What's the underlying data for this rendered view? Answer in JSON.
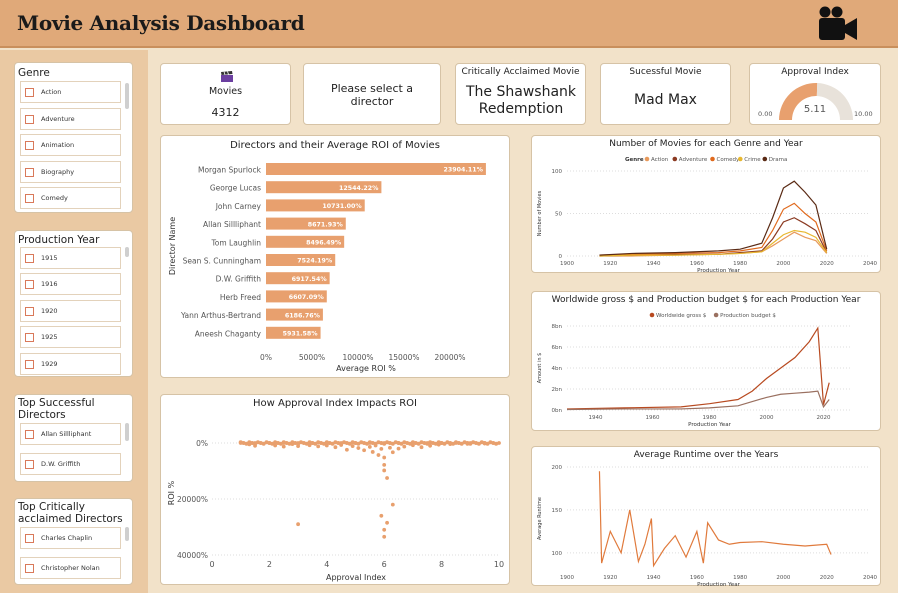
{
  "header": {
    "title": "Movie Analysis Dashboard"
  },
  "colors": {
    "accent": "#e8a06e",
    "dark_orange": "#d9663a",
    "header_bg": "#e0a979"
  },
  "slicers": {
    "genre": {
      "title": "Genre",
      "items": [
        "Action",
        "Adventure",
        "Animation",
        "Biography",
        "Comedy"
      ]
    },
    "year": {
      "title": "Production Year",
      "items": [
        "1915",
        "1916",
        "1920",
        "1925",
        "1929"
      ]
    },
    "top_successful": {
      "title": "Top Successful Directors",
      "items": [
        "Allan Sillliphant",
        "D.W. Griffith"
      ]
    },
    "top_acclaimed": {
      "title": "Top Critically acclaimed Directors",
      "items": [
        "Charles Chaplin",
        "Christopher Nolan"
      ]
    }
  },
  "kpis": {
    "movies": {
      "icon": "clapperboard-icon",
      "label": "Movies",
      "value": "4312"
    },
    "director": {
      "label": "Please select a director"
    },
    "acclaimed": {
      "label": "Critically Acclaimed Movie",
      "value": "The Shawshank Redemption"
    },
    "successful": {
      "label": "Sucessful Movie",
      "value": "Mad Max"
    },
    "approval": {
      "label": "Approval Index",
      "value": 5.11,
      "value_text": "5.11",
      "min": "0.00",
      "max": "10.00"
    }
  },
  "charts": {
    "roi_bar": {
      "title": "Directors and their Average ROI of Movies",
      "ylabel": "Director Name",
      "xlabel": "Average ROI %",
      "xticks": [
        "0%",
        "5000%",
        "10000%",
        "15000%",
        "20000%"
      ],
      "directors": [
        {
          "name": "Morgan Spurlock",
          "label": "23904.11%"
        },
        {
          "name": "George Lucas",
          "label": "12544.22%"
        },
        {
          "name": "John Carney",
          "label": "10731.00%"
        },
        {
          "name": "Allan Sillliphant",
          "label": "8671.93%"
        },
        {
          "name": "Tom Laughlin",
          "label": "8496.49%"
        },
        {
          "name": "Sean S. Cunningham",
          "label": "7524.19%"
        },
        {
          "name": "D.W. Griffith",
          "label": "6917.54%"
        },
        {
          "name": "Herb Freed",
          "label": "6607.09%"
        },
        {
          "name": "Yann Arthus-Bertrand",
          "label": "6186.76%"
        },
        {
          "name": "Aneesh Chaganty",
          "label": "5931.58%"
        }
      ]
    },
    "scatter": {
      "title": "How Approval Index Impacts ROI",
      "ylabel": "ROI %",
      "xlabel": "Approval Index",
      "xticks": [
        "0",
        "2",
        "4",
        "6",
        "8",
        "10"
      ],
      "yticks": [
        "0%",
        "20000%",
        "40000%"
      ]
    },
    "genre_lines": {
      "title": "Number of Movies for each Genre and Year",
      "legend_title": "Genre",
      "legend": [
        "Action",
        "Adventure",
        "Comedy",
        "Crime",
        "Drama"
      ],
      "xlabel": "Production Year",
      "ylabel": "Number of Movies",
      "xticks": [
        "1900",
        "1920",
        "1940",
        "1960",
        "1980",
        "2000",
        "2020",
        "2040"
      ],
      "yticks": [
        "100",
        "50",
        "0"
      ]
    },
    "gross_budget": {
      "title": "Worldwide gross $ and Production budget $ for each Production Year",
      "legend": [
        "Worldwide gross $",
        "Production budget $"
      ],
      "xlabel": "Production Year",
      "ylabel": "Amount in $",
      "xticks": [
        "1940",
        "1960",
        "1980",
        "2000",
        "2020"
      ],
      "yticks": [
        "8bn",
        "6bn",
        "4bn",
        "2bn",
        "0bn"
      ]
    },
    "runtime": {
      "title": "Average Runtime over the Years",
      "xlabel": "Production Year",
      "ylabel": "Average Runtime",
      "xticks": [
        "1900",
        "1920",
        "1940",
        "1960",
        "1980",
        "2000",
        "2020",
        "2040"
      ],
      "yticks": [
        "200",
        "150",
        "100"
      ]
    }
  },
  "chart_data": [
    {
      "type": "bar",
      "title": "Directors and their Average ROI of Movies",
      "categories": [
        "Morgan Spurlock",
        "George Lucas",
        "John Carney",
        "Allan Sillliphant",
        "Tom Laughlin",
        "Sean S. Cunningham",
        "D.W. Griffith",
        "Herb Freed",
        "Yann Arthus-Bertrand",
        "Aneesh Chaganty"
      ],
      "values": [
        23904.11,
        12544.22,
        10731.0,
        8671.93,
        8496.49,
        7524.19,
        6917.54,
        6607.09,
        6186.76,
        5931.58
      ],
      "xlabel": "Average ROI %",
      "ylabel": "Director Name",
      "xlim": [
        0,
        25000
      ]
    },
    {
      "type": "scatter",
      "title": "How Approval Index Impacts ROI",
      "xlabel": "Approval Index",
      "ylabel": "ROI %",
      "xlim": [
        0,
        10
      ],
      "ylim": [
        0,
        40000
      ],
      "points": [
        [
          1.3,
          500
        ],
        [
          1.5,
          1000
        ],
        [
          2.2,
          900
        ],
        [
          2.5,
          1300
        ],
        [
          2.8,
          400
        ],
        [
          3.0,
          1100
        ],
        [
          3.4,
          800
        ],
        [
          3.7,
          1200
        ],
        [
          4.0,
          900
        ],
        [
          4.3,
          1500
        ],
        [
          4.5,
          700
        ],
        [
          4.7,
          2400
        ],
        [
          4.9,
          1100
        ],
        [
          5.1,
          1800
        ],
        [
          5.3,
          2600
        ],
        [
          5.5,
          1400
        ],
        [
          5.6,
          3200
        ],
        [
          5.7,
          900
        ],
        [
          5.8,
          4300
        ],
        [
          5.9,
          2100
        ],
        [
          6.0,
          5200
        ],
        [
          6.0,
          7800
        ],
        [
          6.0,
          9800
        ],
        [
          6.1,
          12500
        ],
        [
          6.2,
          1700
        ],
        [
          6.3,
          3300
        ],
        [
          6.5,
          2000
        ],
        [
          6.7,
          1300
        ],
        [
          7.0,
          800
        ],
        [
          7.3,
          1500
        ],
        [
          7.6,
          1000
        ],
        [
          7.9,
          600
        ],
        [
          8.3,
          400
        ],
        [
          8.9,
          300
        ],
        [
          9.5,
          200
        ],
        [
          3.0,
          29000
        ],
        [
          5.9,
          26000
        ],
        [
          6.0,
          31000
        ],
        [
          6.0,
          33500
        ],
        [
          6.1,
          28500
        ],
        [
          6.3,
          22000
        ],
        [
          1.0,
          0
        ],
        [
          1.5,
          0
        ],
        [
          2.0,
          0
        ],
        [
          2.5,
          0
        ],
        [
          3.0,
          0
        ],
        [
          3.5,
          0
        ],
        [
          4.0,
          0
        ],
        [
          4.5,
          0
        ],
        [
          5.0,
          0
        ],
        [
          5.5,
          0
        ],
        [
          6.0,
          0
        ],
        [
          6.5,
          0
        ],
        [
          7.0,
          0
        ],
        [
          7.5,
          0
        ],
        [
          8.0,
          0
        ],
        [
          8.5,
          0
        ],
        [
          9.0,
          0
        ],
        [
          9.5,
          0
        ],
        [
          10.0,
          0
        ]
      ]
    },
    {
      "type": "line",
      "title": "Number of Movies for each Genre and Year",
      "xlabel": "Production Year",
      "ylabel": "Number of Movies",
      "xlim": [
        1900,
        2040
      ],
      "ylim": [
        0,
        100
      ],
      "series": [
        {
          "name": "Action",
          "x": [
            1915,
            1930,
            1950,
            1970,
            1980,
            1990,
            1995,
            2000,
            2005,
            2010,
            2015,
            2020
          ],
          "values": [
            0,
            0,
            1,
            2,
            3,
            5,
            12,
            20,
            28,
            22,
            18,
            3
          ]
        },
        {
          "name": "Adventure",
          "x": [
            1915,
            1930,
            1950,
            1970,
            1980,
            1990,
            1995,
            2000,
            2005,
            2010,
            2015,
            2020
          ],
          "values": [
            0,
            1,
            2,
            2,
            4,
            6,
            20,
            40,
            45,
            38,
            30,
            4
          ]
        },
        {
          "name": "Comedy",
          "x": [
            1915,
            1930,
            1950,
            1970,
            1980,
            1990,
            1995,
            2000,
            2005,
            2010,
            2015,
            2020
          ],
          "values": [
            1,
            2,
            3,
            4,
            6,
            10,
            30,
            55,
            62,
            50,
            40,
            6
          ]
        },
        {
          "name": "Crime",
          "x": [
            1915,
            1930,
            1950,
            1970,
            1980,
            1990,
            1995,
            2000,
            2005,
            2010,
            2015,
            2020
          ],
          "values": [
            0,
            1,
            1,
            2,
            3,
            5,
            15,
            25,
            30,
            28,
            22,
            4
          ]
        },
        {
          "name": "Drama",
          "x": [
            1915,
            1930,
            1950,
            1970,
            1980,
            1990,
            1995,
            2000,
            2005,
            2010,
            2015,
            2020
          ],
          "values": [
            1,
            3,
            4,
            6,
            8,
            15,
            45,
            80,
            88,
            75,
            60,
            8
          ]
        }
      ]
    },
    {
      "type": "line",
      "title": "Worldwide gross $ and Production budget $ for each Production Year",
      "xlabel": "Production Year",
      "ylabel": "Amount in $",
      "xlim": [
        1930,
        2030
      ],
      "ylim": [
        0,
        8
      ],
      "series": [
        {
          "name": "Worldwide gross $",
          "x": [
            1930,
            1950,
            1970,
            1980,
            1990,
            1995,
            2000,
            2005,
            2010,
            2015,
            2018,
            2020,
            2022
          ],
          "values": [
            0.1,
            0.2,
            0.3,
            0.6,
            1.0,
            1.8,
            3.0,
            4.0,
            5.0,
            6.5,
            7.8,
            0.5,
            2.6
          ]
        },
        {
          "name": "Production budget $",
          "x": [
            1930,
            1950,
            1970,
            1980,
            1990,
            1995,
            2000,
            2005,
            2010,
            2015,
            2018,
            2020,
            2022
          ],
          "values": [
            0.05,
            0.1,
            0.1,
            0.2,
            0.4,
            0.8,
            1.2,
            1.5,
            1.6,
            1.7,
            1.8,
            0.3,
            1.0
          ]
        }
      ]
    },
    {
      "type": "line",
      "title": "Average Runtime over the Years",
      "xlabel": "Production Year",
      "ylabel": "Average Runtime",
      "xlim": [
        1900,
        2040
      ],
      "ylim": [
        80,
        200
      ],
      "series": [
        {
          "name": "Average Runtime",
          "x": [
            1915,
            1916,
            1920,
            1925,
            1929,
            1933,
            1936,
            1939,
            1940,
            1945,
            1950,
            1955,
            1960,
            1963,
            1965,
            1970,
            1975,
            1980,
            1990,
            2000,
            2010,
            2020,
            2022
          ],
          "values": [
            195,
            88,
            125,
            100,
            150,
            90,
            110,
            140,
            85,
            105,
            120,
            95,
            125,
            88,
            135,
            115,
            110,
            112,
            113,
            110,
            108,
            110,
            98
          ]
        }
      ]
    }
  ]
}
